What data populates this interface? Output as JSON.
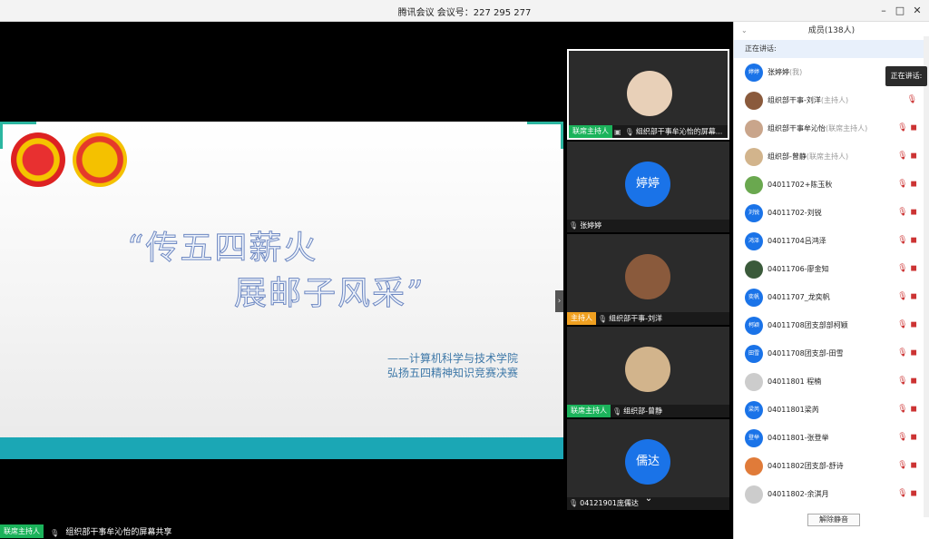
{
  "window": {
    "title": "腾讯会议 会议号：227 295 277",
    "minimize": "–",
    "maximize": "□",
    "close": "✕"
  },
  "slide": {
    "line1": "“传五四薪火",
    "line2": "展邮子风采”",
    "sub1": "——计算机科学与技术学院",
    "sub2": "弘扬五四精神知识竞赛决赛"
  },
  "share_bar": {
    "role": "联席主持人",
    "text": "组织部干事牟沁怡的屏幕共享"
  },
  "tiles": [
    {
      "role": "联席主持人",
      "name": "组织部干事牟沁怡的屏幕...",
      "avatar": ""
    },
    {
      "role": "",
      "name": "张婷婷",
      "avatar": "婷婷"
    },
    {
      "role": "主持人",
      "name": "组织部干事-刘洋",
      "avatar": ""
    },
    {
      "role": "联席主持人",
      "name": "组织部-曾静",
      "avatar": ""
    },
    {
      "role": "",
      "name": "04121901庞儒达",
      "avatar": "儒达"
    }
  ],
  "panel": {
    "title": "成员(138人)",
    "speaking_label": "正在讲话:",
    "tooltip": "正在讲话:",
    "unmute_button": "解除静音",
    "members": [
      {
        "avatar": "婷婷",
        "name": "张婷婷",
        "role": "(我)",
        "color": "#1a73e8"
      },
      {
        "avatar": "",
        "name": "组织部干事-刘洋",
        "role": "(主持人)",
        "color": "#8a5a3c"
      },
      {
        "avatar": "",
        "name": "组织部干事牟沁怡",
        "role": "(联席主持人)",
        "color": "#c9a58b"
      },
      {
        "avatar": "",
        "name": "组织部-曾静",
        "role": "(联席主持人)",
        "color": "#d2b48c"
      },
      {
        "avatar": "",
        "name": "04011702+陈玉秋",
        "role": "",
        "color": "#6aa84f"
      },
      {
        "avatar": "刘锐",
        "name": "04011702-刘锐",
        "role": "",
        "color": "#1a73e8"
      },
      {
        "avatar": "鸿泽",
        "name": "04011704吕鸿泽",
        "role": "",
        "color": "#1a73e8"
      },
      {
        "avatar": "",
        "name": "04011706-廖金知",
        "role": "",
        "color": "#3a5a3a"
      },
      {
        "avatar": "奕帆",
        "name": "04011707_龙奕帆",
        "role": "",
        "color": "#1a73e8"
      },
      {
        "avatar": "柯颖",
        "name": "04011708团支部部柯颖",
        "role": "",
        "color": "#1a73e8"
      },
      {
        "avatar": "田雪",
        "name": "04011708团支部-田雪",
        "role": "",
        "color": "#1a73e8"
      },
      {
        "avatar": "",
        "name": "04011801 程楠",
        "role": "",
        "color": "#cccccc"
      },
      {
        "avatar": "梁芮",
        "name": "04011801梁芮",
        "role": "",
        "color": "#1a73e8"
      },
      {
        "avatar": "登举",
        "name": "04011801-张登举",
        "role": "",
        "color": "#1a73e8"
      },
      {
        "avatar": "",
        "name": "04011802团支部-舒诗",
        "role": "",
        "color": "#e07b39"
      },
      {
        "avatar": "",
        "name": "04011802-余淇月",
        "role": "",
        "color": "#cccccc"
      }
    ]
  }
}
